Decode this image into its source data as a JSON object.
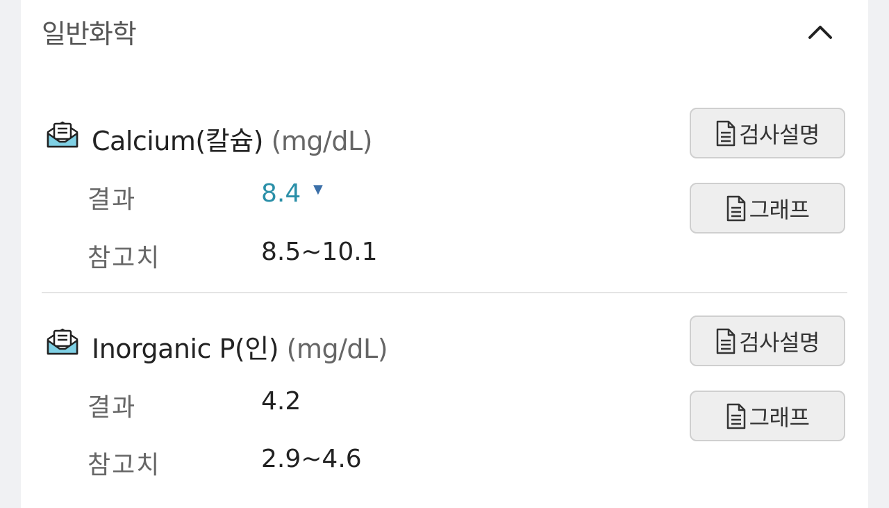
{
  "section": {
    "title": "일반화학",
    "collapse_icon": "chevron-up-icon"
  },
  "tests": [
    {
      "icon": "envelope-open-icon",
      "name": "Calcium(칼슘)",
      "unit": "(mg/dL)",
      "result_label": "결과",
      "result_value": "8.4",
      "result_flag": "▼",
      "reference_label": "참고치",
      "reference_value": "8.5~10.1",
      "explain_button": "검사설명",
      "graph_button": "그래프"
    },
    {
      "icon": "envelope-open-icon",
      "name": "Inorganic P(인)",
      "unit": "(mg/dL)",
      "result_label": "결과",
      "result_value": "4.2",
      "reference_label": "참고치",
      "reference_value": "2.9~4.6",
      "explain_button": "검사설명",
      "graph_button": "그래프"
    }
  ],
  "colors": {
    "low_value": "#2a8fa8",
    "low_marker": "#3b6fa8",
    "icon_accent": "#7fd0e4"
  }
}
